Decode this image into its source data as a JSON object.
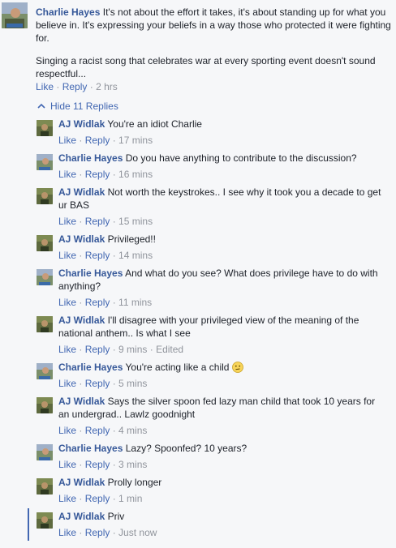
{
  "top_comment": {
    "author": "Charlie Hayes",
    "paragraph1": "It's not about the effort it takes, it's about standing up for what you believe in. It's expressing your beliefs in a way those who protected it were fighting for.",
    "paragraph2": "Singing a racist song that celebrates war at every sporting event doesn't sound respectful...",
    "like": "Like",
    "reply": "Reply",
    "time": "2 hrs"
  },
  "replies_toggle": {
    "label": "Hide 11 Replies"
  },
  "replies": [
    {
      "author": "AJ Widlak",
      "text": "You're an idiot Charlie",
      "like": "Like",
      "reply": "Reply",
      "time": "17 mins"
    },
    {
      "author": "Charlie Hayes",
      "text": "Do you have anything to contribute to the discussion?",
      "like": "Like",
      "reply": "Reply",
      "time": "16 mins"
    },
    {
      "author": "AJ Widlak",
      "text": "Not worth the keystrokes.. I see why it took you a decade to get ur BAS",
      "like": "Like",
      "reply": "Reply",
      "time": "15 mins"
    },
    {
      "author": "AJ Widlak",
      "text": "Privileged!!",
      "like": "Like",
      "reply": "Reply",
      "time": "14 mins"
    },
    {
      "author": "Charlie Hayes",
      "text": "And what do you see? What does privilege have to do with anything?",
      "like": "Like",
      "reply": "Reply",
      "time": "11 mins"
    },
    {
      "author": "AJ Widlak",
      "text": "I'll disagree with your privileged view of the meaning of the national anthem.. Is what I see",
      "like": "Like",
      "reply": "Reply",
      "time": "9 mins",
      "edited": "Edited"
    },
    {
      "author": "Charlie Hayes",
      "text": "You're acting like a child",
      "like": "Like",
      "reply": "Reply",
      "time": "5 mins"
    },
    {
      "author": "AJ Widlak",
      "text": "Says the silver spoon fed lazy man child that took 10 years for an undergrad.. Lawlz goodnight",
      "like": "Like",
      "reply": "Reply",
      "time": "4 mins"
    },
    {
      "author": "Charlie Hayes",
      "text": "Lazy? Spoonfed? 10 years?",
      "like": "Like",
      "reply": "Reply",
      "time": "3 mins"
    },
    {
      "author": "AJ Widlak",
      "text": "Prolly longer",
      "like": "Like",
      "reply": "Reply",
      "time": "1 min"
    },
    {
      "author": "AJ Widlak",
      "text": "Priv",
      "like": "Like",
      "reply": "Reply",
      "time": "Just now"
    }
  ],
  "colors": {
    "link": "#365899",
    "action": "#4267b2",
    "meta": "#90949c",
    "background": "#f6f7f9"
  }
}
